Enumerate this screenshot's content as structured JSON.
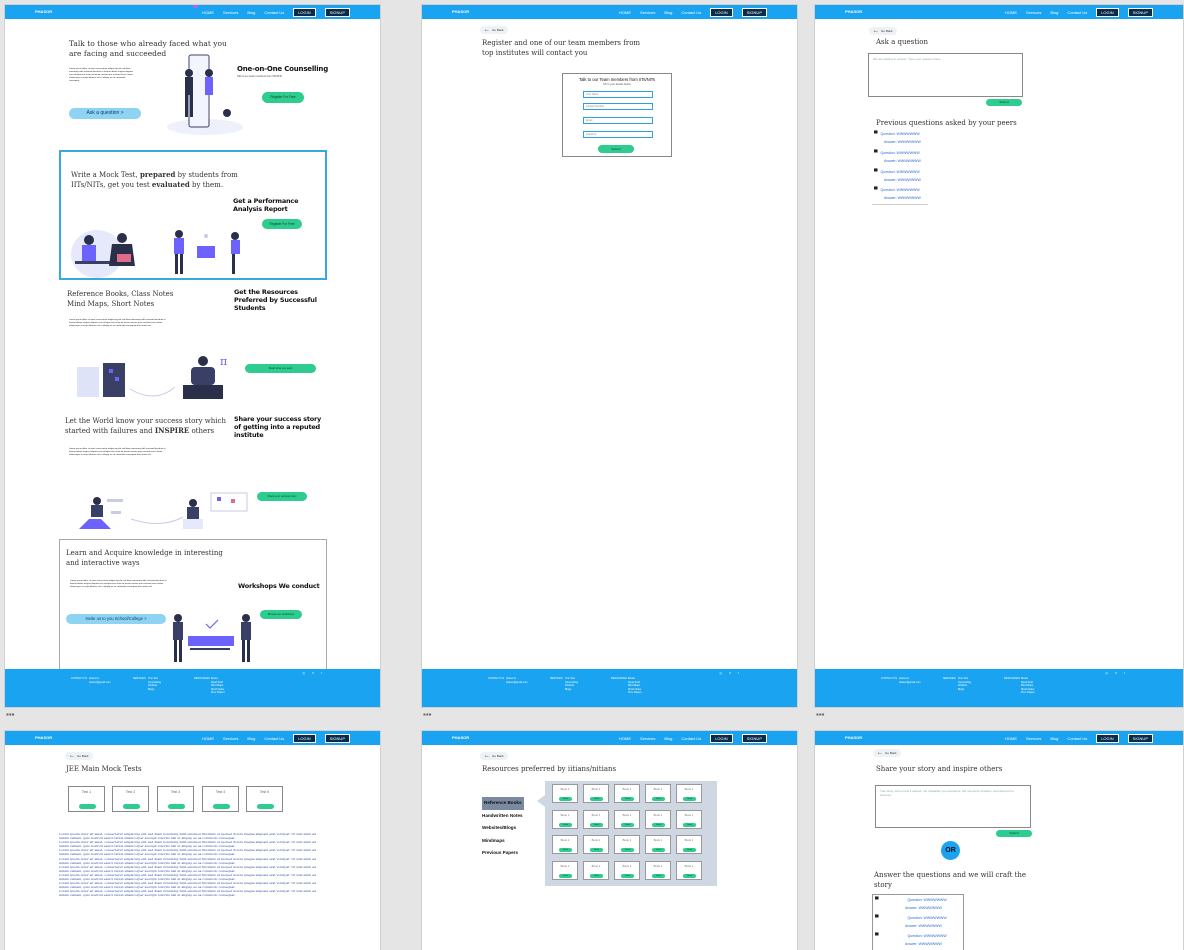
{
  "nav": {
    "brand": "PHASOR",
    "home": "HOME",
    "services": "Services",
    "blog": "Blog",
    "contact": "Contact Us",
    "login": "LOGIN",
    "signup": "SIGNUP"
  },
  "footer": {
    "contact_label": "CONTACT US",
    "contact_lines": "phasor.in\nphasor@gmail.com",
    "services_label": "SERVICES",
    "services_list": "One Test\nCounselling\nWebinar\nBlogs",
    "resources_label": "RESOURCES",
    "resources_list": "Books\nRead Stuff\nMind Maps\nShort Notes\nPrev Papers",
    "social": "◎ ✕ f"
  },
  "home": {
    "intro_title": "Talk to those who already faced what you are facing and succeeded",
    "counselling_heading": "One-on-One Counselling",
    "counselling_sub": "Talk to our team members from IITs/NITs",
    "register_btn": "Register For Free",
    "ask_btn": "Ask a question  >",
    "mock_text_pre": "Write a Mock Test, ",
    "mock_prepared": "prepared",
    "mock_text_mid": " by students from IITs/NITs, get you test ",
    "mock_evaluated": "evaluated",
    "mock_text_end": " by them.",
    "perf_heading": "Get a Performance Analysis Report",
    "register_btn2": "Register For Free",
    "ref_title": "Reference Books, Class Notes Mind Maps, Short Notes",
    "resources_heading": "Get the Resources Preferred by Successful Students",
    "resources_btn": "Read what you want",
    "success_pre": "Let the World know your success story which started with failures and ",
    "success_inspire": "INSPIRE",
    "success_post": " others",
    "share_heading": "Share your success story of getting into a reputed institute",
    "share_btn": "Share your success story",
    "workshop_title": "Learn and Acquire knowledge in interesting and interactive ways",
    "workshop_heading": "Workshops We conduct",
    "workshop_btn": "Browse our workshops",
    "invite_btn": "Invite us to you School/College  >"
  },
  "register_page": {
    "back": "Go Back",
    "title": "Register and one of our team members from top institutes will contact you",
    "form_title": "Talk to our Team members from IITs/NITs",
    "form_sub": "Fill in your details below",
    "f_name": "Your Name",
    "f_contact": "Contact Number",
    "f_email": "Email",
    "f_academy": "Academy",
    "submit": "Submit"
  },
  "ask_page": {
    "back": "Go Back",
    "title": "Ask a question",
    "placeholder": "We are waiting to answer. Type your question here.",
    "submit": "Submit",
    "prev_title": "Previous questions asked by your peers",
    "q_label": "Question: ",
    "a_label": "Answer: ",
    "q_text": "WWWWWWW",
    "a_text": "WWWWWWW"
  },
  "mock_page": {
    "back": "Go Back",
    "title": "JEE Main Mock Tests",
    "tests": [
      "Test 1",
      "Test 2",
      "Test 3",
      "Test 4",
      "Test 5"
    ],
    "lorem": "Lorem ipsum dolor sit amet, consectetur adipiscing elit, sed diam nonummy nibh euismod tincidunt ut laoreet dolore magna aliquam erat volutpat. Ut wisi enim ad minim veniam, quis nostrud exerci tation ullamcorper suscipit lobortis nisl ut aliquip ex ea commodo consequat."
  },
  "resources_page": {
    "back": "Go Back",
    "title": "Resources preferred by iitians/nitians",
    "menu": [
      "Reference Books",
      "Handwritten Notes",
      "Websites/Blogs",
      "Mindmaps",
      "Previous Papers"
    ],
    "book_label": "Book 1",
    "read_label": "Read"
  },
  "story_page": {
    "back": "Go Back",
    "title": "Share your story and inspire others",
    "placeholder": "Your story, tell us how it started, the obstacles you overcame, the moments of failure, and what led to success.",
    "submit": "Submit",
    "or": "OR",
    "answer_title": "Answer the questions and we will craft the story",
    "q_label": "Question: ",
    "a_label": "Answer: ",
    "q_text": "WWWWWWW",
    "a_text": "WWWWWWW"
  },
  "colors": {
    "primary": "#1aa3f0",
    "accent_green": "#2ecc8f",
    "ask_blue": "#8fd3f4",
    "mock_border": "#3aa8e0"
  }
}
